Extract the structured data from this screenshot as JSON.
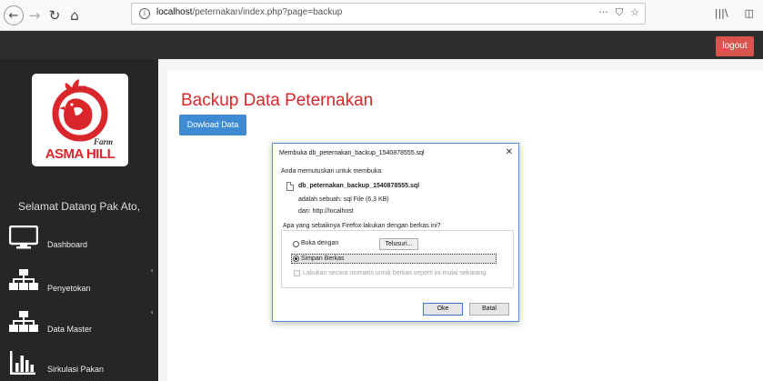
{
  "browser": {
    "url_host": "localhost",
    "url_path": "/peternakan/index.php?page=backup",
    "page_actions": "···",
    "library_glyph": "|||\\"
  },
  "header": {
    "logout_label": "logout"
  },
  "sidebar": {
    "logo_text": "ASMA HILL",
    "logo_farm": "Farm",
    "welcome": "Selamat Datang Pak Ato,",
    "items": [
      {
        "label": "Dashboard",
        "icon": "monitor-icon",
        "has_submenu": false
      },
      {
        "label": "Penyetokan",
        "icon": "sitemap-icon",
        "has_submenu": true
      },
      {
        "label": "Data Master",
        "icon": "sitemap-icon",
        "has_submenu": true
      },
      {
        "label": "Sirkulasi Pakan",
        "icon": "bar-chart-icon",
        "has_submenu": false
      }
    ],
    "caret": "‹"
  },
  "main": {
    "title": "Backup Data Peternakan",
    "download_label": "Dowload Data"
  },
  "dialog": {
    "title": "Membuka db_peternakan_backup_1540878555.sql",
    "intro": "Anda memutuskan untuk membuka:",
    "file_name": "db_peternakan_backup_1540878555.sql",
    "file_type": "adalah sebuah:  sql File (6,3 KB)",
    "file_from": "dari:  http://localhost",
    "question": "Apa yang sebaiknya Firefox lakukan dengan berkas ini?",
    "open_with_label": "Buka dengan",
    "browse_label": "Telusuri...",
    "save_label": "Simpan Berkas",
    "auto_label": "Lakukan secara otomatis untuk berkas seperti ini mulai sekarang.",
    "ok_label": "Oke",
    "cancel_label": "Batal",
    "close_glyph": "✕",
    "selected_option": "Simpan Berkas"
  },
  "colors": {
    "accent_red": "#d8262b",
    "button_blue": "#3f8bd3",
    "sidebar_bg": "#262626",
    "logout_bg": "#d9534f"
  }
}
